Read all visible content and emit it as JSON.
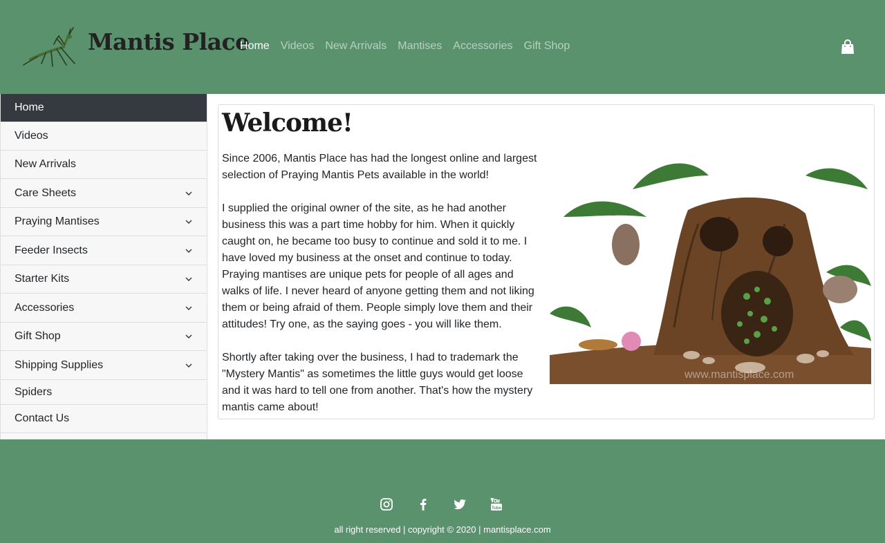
{
  "header": {
    "logo_text": "Mantis Place",
    "nav": [
      {
        "label": "Home",
        "active": true
      },
      {
        "label": "Videos",
        "active": false
      },
      {
        "label": "New Arrivals",
        "active": false
      },
      {
        "label": "Mantises",
        "active": false
      },
      {
        "label": "Accessories",
        "active": false
      },
      {
        "label": "Gift Shop",
        "active": false
      }
    ],
    "cart_icon": "shopping-bag-icon"
  },
  "sidebar": {
    "items": [
      {
        "label": "Home",
        "active": true,
        "expandable": false
      },
      {
        "label": "Videos",
        "active": false,
        "expandable": false
      },
      {
        "label": "New Arrivals",
        "active": false,
        "expandable": false
      },
      {
        "label": "Care Sheets",
        "active": false,
        "expandable": true
      },
      {
        "label": "Praying Mantises",
        "active": false,
        "expandable": true
      },
      {
        "label": "Feeder Insects",
        "active": false,
        "expandable": true
      },
      {
        "label": "Starter Kits",
        "active": false,
        "expandable": true
      },
      {
        "label": "Accessories",
        "active": false,
        "expandable": true
      },
      {
        "label": "Gift Shop",
        "active": false,
        "expandable": true
      },
      {
        "label": "Shipping Supplies",
        "active": false,
        "expandable": true
      },
      {
        "label": "Spiders",
        "active": false,
        "expandable": false
      },
      {
        "label": "Contact Us",
        "active": false,
        "expandable": false
      }
    ]
  },
  "main": {
    "title": "Welcome!",
    "paragraphs": [
      "Since 2006, Mantis Place has had the longest online and largest selection of Praying Mantis Pets available in the world!",
      "I supplied the original owner of the site, as he had another business this was a part time hobby for him. When it quickly caught on, he became too busy to continue and sold it to me. I have loved my business at the onset and continue to today. Praying mantises are unique pets for people of all ages and walks of life. I never heard of anyone getting them and not liking them or being afraid of them. People simply love them and their attitudes! Try one, as the saying goes - you will like them.",
      "Shortly after taking over the business, I had to trademark the \"Mystery Mantis\" as sometimes the little guys would get loose and it was hard to tell one from another. That's how the mystery mantis came about!"
    ],
    "image_watermark": "www.mantisplace.com"
  },
  "footer": {
    "socials": [
      "instagram-icon",
      "facebook-icon",
      "twitter-icon",
      "youtube-icon"
    ],
    "copyright": "all right reserved | copyright © 2020 | mantisplace.com"
  },
  "colors": {
    "header_bg": "#5b926e",
    "nav_active": "#ffffff",
    "nav_inactive": "#b5d2bf",
    "sidebar_active_bg": "#343a40"
  }
}
